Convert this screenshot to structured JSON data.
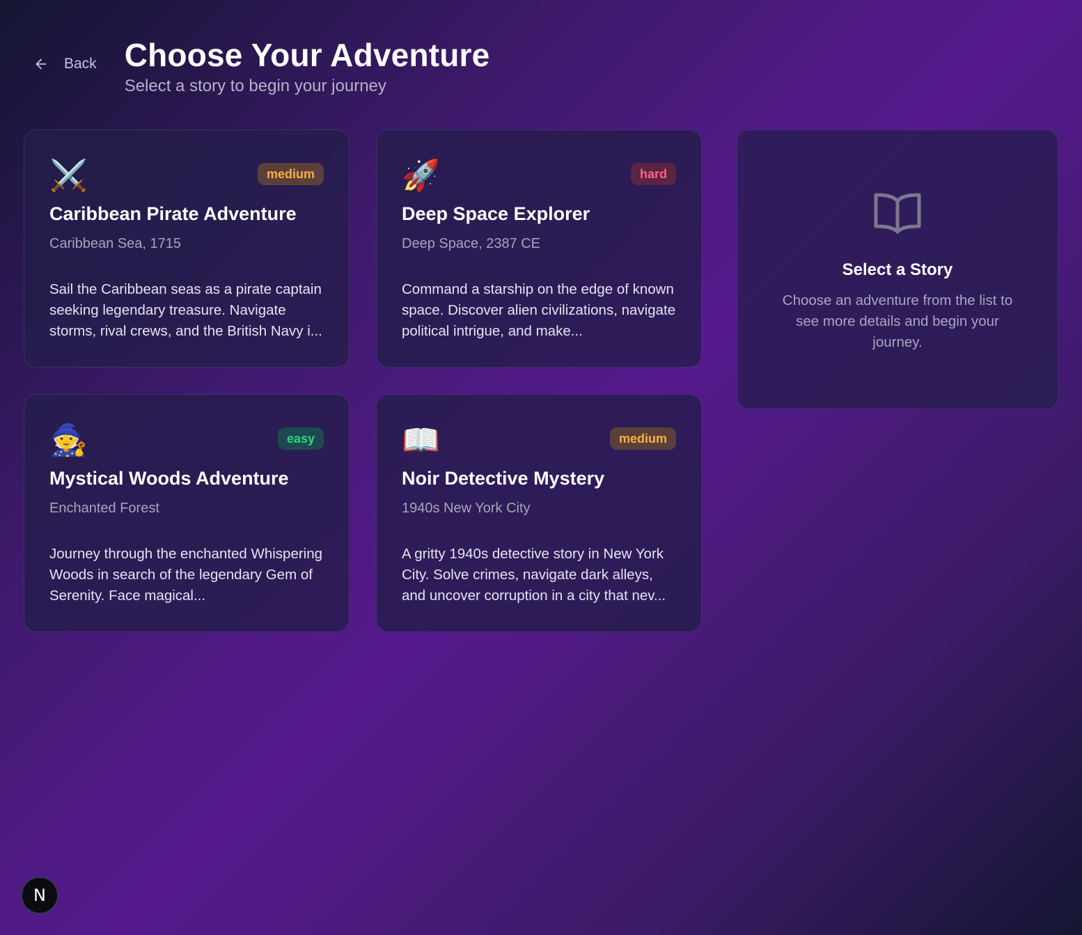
{
  "header": {
    "back_label": "Back",
    "title": "Choose Your Adventure",
    "subtitle": "Select a story to begin your journey"
  },
  "stories": [
    {
      "icon": "crossed-swords-icon",
      "emoji": "⚔️",
      "difficulty": "medium",
      "title": "Caribbean Pirate Adventure",
      "setting": "Caribbean Sea, 1715",
      "description": "Sail the Caribbean seas as a pirate captain seeking legendary treasure. Navigate storms, rival crews, and the British Navy i..."
    },
    {
      "icon": "rocket-icon",
      "emoji": "🚀",
      "difficulty": "hard",
      "title": "Deep Space Explorer",
      "setting": "Deep Space, 2387 CE",
      "description": "Command a starship on the edge of known space. Discover alien civilizations, navigate political intrigue, and make..."
    },
    {
      "icon": "wizard-icon",
      "emoji": "🧙",
      "difficulty": "easy",
      "title": "Mystical Woods Adventure",
      "setting": "Enchanted Forest",
      "description": "Journey through the enchanted Whispering Woods in search of the legendary Gem of Serenity. Face magical..."
    },
    {
      "icon": "open-book-icon",
      "emoji": "📖",
      "difficulty": "medium",
      "title": "Noir Detective Mystery",
      "setting": "1940s New York City",
      "description": "A gritty 1940s detective story in New York City. Solve crimes, navigate dark alleys, and uncover corruption in a city that nev..."
    }
  ],
  "detail_panel": {
    "icon": "book-outline-icon",
    "title": "Select a Story",
    "text": "Choose an adventure from the list to see more details and begin your journey."
  },
  "dev_badge": {
    "label": "N"
  },
  "colors": {
    "easy": "#2fd57a",
    "medium": "#f7b13b",
    "hard": "#ff6280"
  }
}
